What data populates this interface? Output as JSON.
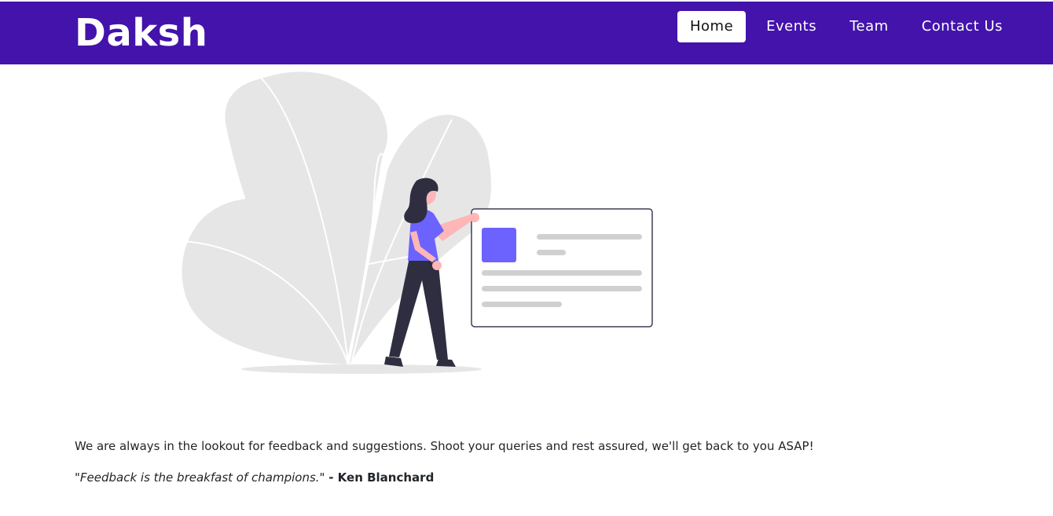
{
  "navbar": {
    "brand": "Daksh",
    "items": [
      {
        "label": "Home",
        "active": true
      },
      {
        "label": "Events",
        "active": false
      },
      {
        "label": "Team",
        "active": false
      },
      {
        "label": "Contact Us",
        "active": false
      }
    ],
    "background_color": "#4313ab"
  },
  "illustration": {
    "icon": "person-presenting-card-illustration",
    "accent_color": "#6c63ff"
  },
  "main": {
    "description": "We are always in the lookout for feedback and suggestions. Shoot your queries and rest assured, we'll get back to you ASAP!",
    "quote_text": "\"Feedback is the breakfast of champions.\"",
    "quote_author": "- Ken Blanchard"
  }
}
